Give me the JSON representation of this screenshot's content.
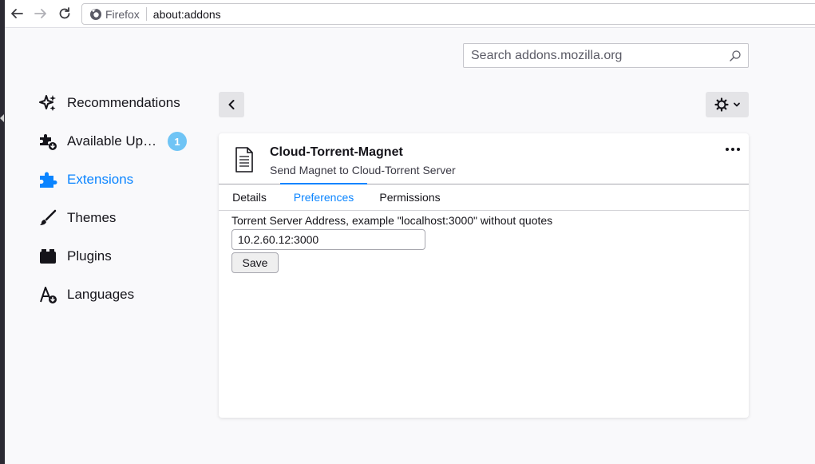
{
  "browser": {
    "identity": "Firefox",
    "url": "about:addons"
  },
  "search": {
    "placeholder": "Search addons.mozilla.org"
  },
  "sidebar": {
    "items": [
      {
        "label": "Recommendations",
        "icon": "sparkles-icon"
      },
      {
        "label": "Available Up…",
        "icon": "puzzle-update-icon",
        "badge": "1"
      },
      {
        "label": "Extensions",
        "icon": "puzzle-icon",
        "selected": true
      },
      {
        "label": "Themes",
        "icon": "brush-icon"
      },
      {
        "label": "Plugins",
        "icon": "plugin-icon"
      },
      {
        "label": "Languages",
        "icon": "language-icon"
      }
    ]
  },
  "addon": {
    "name": "Cloud-Torrent-Magnet",
    "description": "Send Magnet to Cloud-Torrent Server",
    "tabs": [
      "Details",
      "Preferences",
      "Permissions"
    ],
    "active_tab": "Preferences"
  },
  "preferences": {
    "label": "Torrent Server Address, example \"localhost:3000\" without quotes",
    "value": "10.2.60.12:3000",
    "save_label": "Save"
  },
  "colors": {
    "accent": "#0a84ff",
    "badge": "#6fc4f5"
  }
}
